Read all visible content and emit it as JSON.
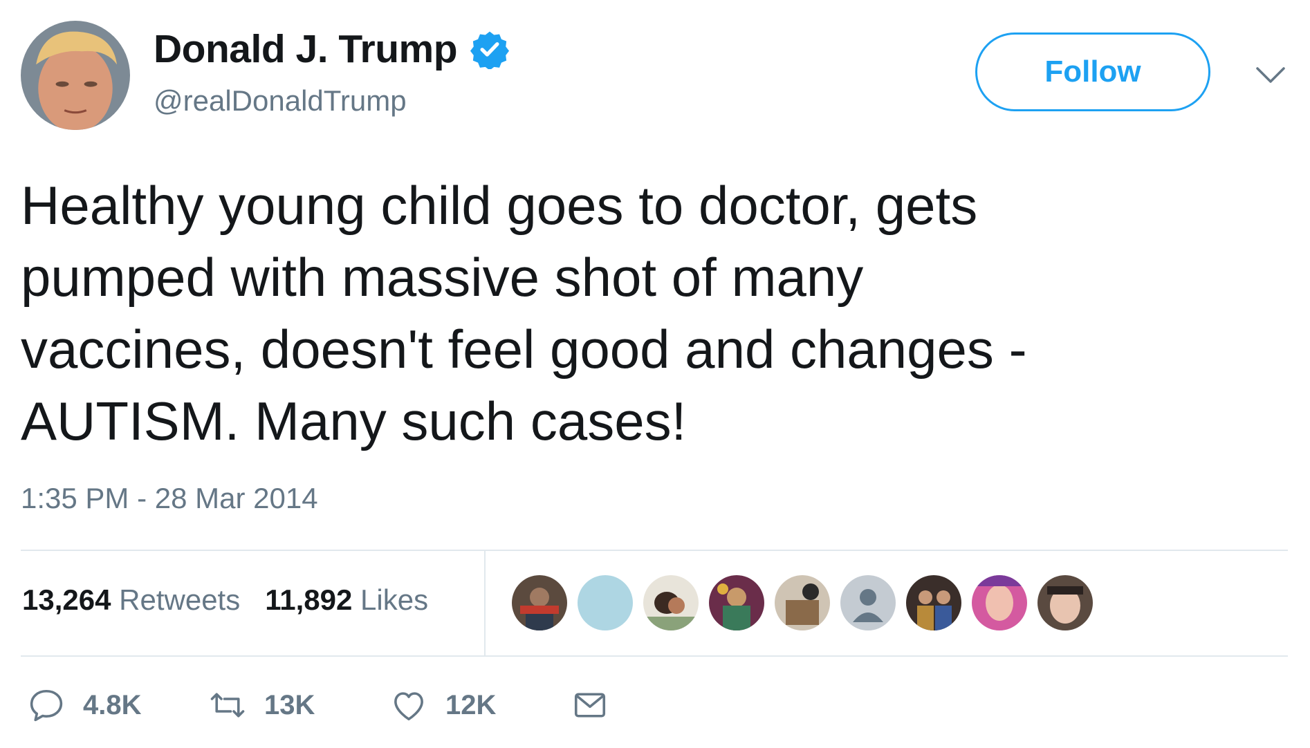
{
  "author": {
    "display_name": "Donald J. Trump",
    "handle": "@realDonaldTrump",
    "verified": true
  },
  "follow_button": {
    "label": "Follow"
  },
  "tweet": {
    "text": "Healthy young child goes to doctor, gets\npumped with massive shot of many\nvaccines, doesn't feel good and changes -\nAUTISM. Many such cases!",
    "timestamp": "1:35 PM - 28 Mar 2014"
  },
  "stats": {
    "retweets_count": "13,264",
    "retweets_label": "Retweets",
    "likes_count": "11,892",
    "likes_label": "Likes"
  },
  "likers": [
    {
      "icon": "liker-avatar"
    },
    {
      "icon": "liker-avatar"
    },
    {
      "icon": "liker-avatar"
    },
    {
      "icon": "liker-avatar"
    },
    {
      "icon": "liker-avatar"
    },
    {
      "icon": "default-avatar"
    },
    {
      "icon": "liker-avatar"
    },
    {
      "icon": "liker-avatar"
    },
    {
      "icon": "liker-avatar"
    }
  ],
  "actions": {
    "reply_count": "4.8K",
    "retweet_count": "13K",
    "like_count": "12K"
  },
  "colors": {
    "accent": "#1da1f2",
    "text": "#14171a",
    "secondary_text": "#657786",
    "divider": "#e1e8ed"
  }
}
